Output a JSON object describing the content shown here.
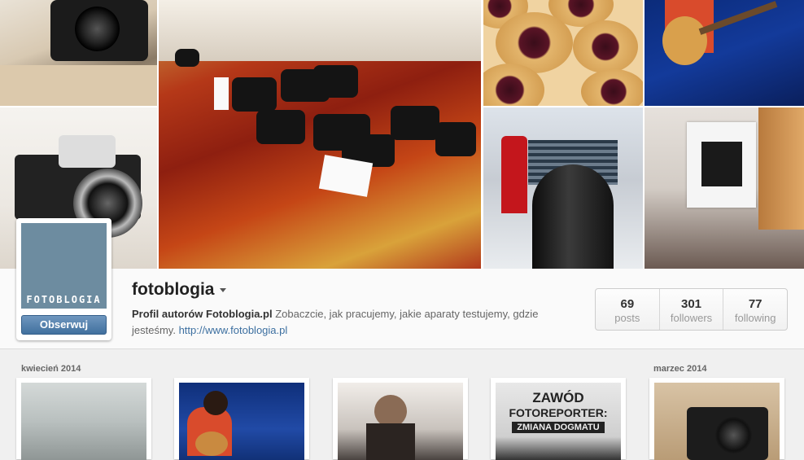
{
  "profile": {
    "username": "fotoblogia",
    "avatar_text": "FOTOBLOGIA",
    "follow_label": "Obserwuj",
    "bio_bold": "Profil autorów Fotoblogia.pl",
    "bio_text": " Zobaczcie, jak pracujemy, jakie aparaty testujemy, gdzie jesteśmy. ",
    "bio_link": "http://www.fotoblogia.pl"
  },
  "stats": [
    {
      "value": "69",
      "label": "posts"
    },
    {
      "value": "301",
      "label": "followers"
    },
    {
      "value": "77",
      "label": "following"
    }
  ],
  "feed": {
    "months": [
      "kwiecień 2014",
      "marzec 2014"
    ],
    "poster": {
      "line1": "ZAWÓD",
      "line2": "FOTOREPORTER:",
      "line3": "ZMIANA DOGMATU"
    }
  },
  "colors": {
    "avatar_bg": "#6d8ca0",
    "button_blue": "#41709e",
    "link_blue": "#3c6fa0"
  }
}
